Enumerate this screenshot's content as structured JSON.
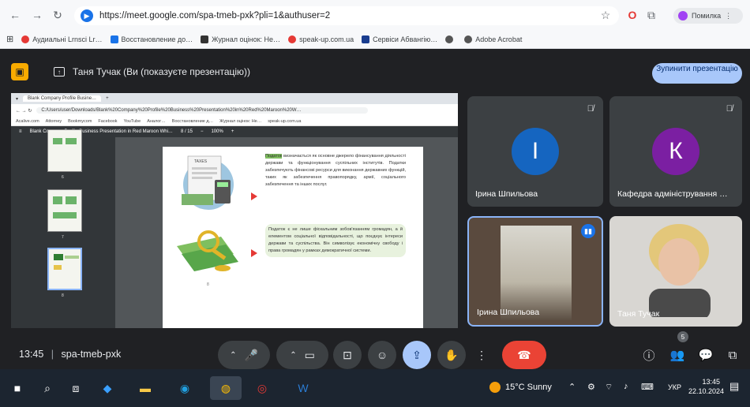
{
  "browser": {
    "url": "https://meet.google.com/spa-tmeb-pxk?pli=1&authuser=2",
    "profile_label": "Помилка",
    "bookmarks": [
      "Аудиальні Lrnsci Lr…",
      "Восстановление до…",
      "Журнал оцінок: Не…",
      "speak-up.com.ua",
      "Сервіси Абвангію…",
      "",
      "Adobe Acrobat"
    ]
  },
  "meet": {
    "presenter_title": "Таня Тучак (Ви (показуєте презентацію))",
    "stop_button": "Зупинити презентацію",
    "meeting_time": "13:45",
    "meeting_code": "spa-tmeb-pxk",
    "people_count": "5",
    "participants": [
      {
        "name": "Ірина Шпильова",
        "initial": "І",
        "color": "#1565c0"
      },
      {
        "name": "Кафедра адміністрування …",
        "initial": "К",
        "color": "#7b1fa2"
      },
      {
        "name": "Ірина Шпильова",
        "initial": "",
        "color": ""
      },
      {
        "name": "Таня Тучак",
        "initial": "",
        "color": ""
      }
    ]
  },
  "shared_screen": {
    "tab_title": "Blank Company Profile Busine…",
    "inner_url": "C:/Users/user/Downloads/Blank%20Company%20Profile%20Business%20Presentation%20in%20Red%20Maroon%20W…",
    "inner_bookmarks": [
      "Acalive.com",
      "Attorney",
      "Bookmycom",
      "Facebook",
      "YouTube",
      "Аналог…",
      "Восстановление д…",
      "Журнал оцінок: Не…",
      "speak-up.com.ua"
    ],
    "pdf_title": "Blank Company Profile Business Presentation in Red Maroon Whi…",
    "pdf_page": "8 / 15",
    "pdf_zoom": "100%",
    "thumb_numbers": [
      "6",
      "7",
      "8"
    ],
    "para1_highlight": "Податок",
    "para1": " визначається як основне джерело фінансування діяльності держави та функціонування суспільних інститутів. Податки забезпечують фінансові ресурси для виконання державних функцій, таких як забезпечення правопорядку, армії, соціального забезпечення та інших послуг.",
    "para2": "Податок є не лише фіскальним зобов'язанням громадян, а й елементом соціальної відповідальності, що поєднує інтереси держави та суспільства. Він символізує економічну свободу і права громадян у рамках демократичної системи.",
    "taxes_label": "TAXES",
    "page_number_mark": "8"
  },
  "taskbar": {
    "weather": "15°C Sunny",
    "lang": "УКР",
    "time": "13:45",
    "date": "22.10.2024"
  }
}
